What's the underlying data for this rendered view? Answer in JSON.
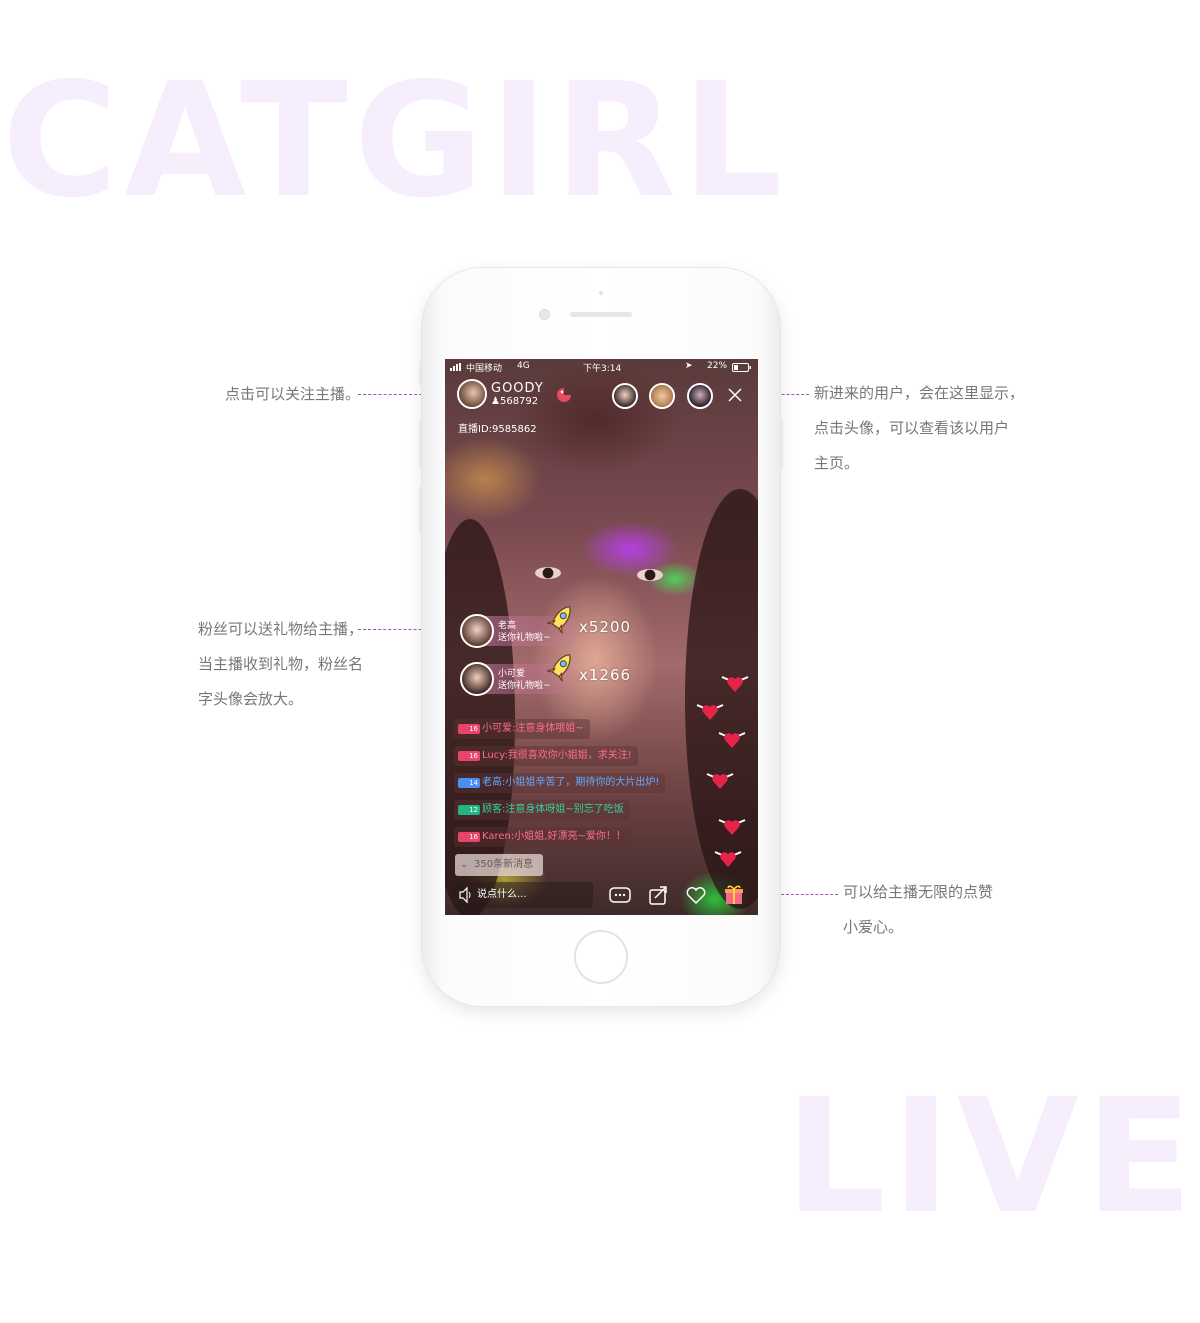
{
  "background_words": {
    "top": "CATGIRL",
    "bottom": "LIVE"
  },
  "annotations": {
    "follow": "点击可以关注主播。",
    "new_users": [
      "新进来的用户，会在这里显示，",
      "点击头像，可以查看该以用户",
      "主页。"
    ],
    "gifts": [
      "粉丝可以送礼物给主播，",
      "当主播收到礼物，粉丝名",
      "字头像会放大。"
    ],
    "likes": [
      "可以给主播无限的点赞",
      "小爱心。"
    ]
  },
  "status_bar": {
    "carrier": "中国移动",
    "network": "4G",
    "time": "下午3:14",
    "battery": "22%"
  },
  "host": {
    "name": "GOODY",
    "followers": "568792",
    "room_id": "直播ID:9585862"
  },
  "viewers_icons": [
    "viewer-avatar-icon",
    "viewer-avatar-icon",
    "viewer-avatar-icon"
  ],
  "gifts": [
    {
      "name": "老高",
      "text": "送你礼物啦~",
      "count": "x5200",
      "icon": "rocket-icon"
    },
    {
      "name": "小可爱",
      "text": "送你礼物啦~",
      "count": "x1266",
      "icon": "rocket-icon"
    }
  ],
  "messages": [
    {
      "level": "16",
      "text": "小可爱:注意身体哦姐~",
      "color": "#ff6b8a",
      "badge": "#e8456a"
    },
    {
      "level": "16",
      "text": "Lucy:我很喜欢你小姐姐，求关注!",
      "color": "#ff6b8a",
      "badge": "#e8456a"
    },
    {
      "level": "14",
      "text": "老高:小姐姐辛苦了，期待你的大片出炉!",
      "color": "#63a8ff",
      "badge": "#4a8ef0"
    },
    {
      "level": "12",
      "text": "顾客:注意身体呀姐~别忘了吃饭",
      "color": "#35d2a0",
      "badge": "#22b584"
    },
    {
      "level": "16",
      "text": "Karen:小姐姐,好漂亮~爱你！！",
      "color": "#ff6b8a",
      "badge": "#e8456a"
    }
  ],
  "new_messages": "350条新消息",
  "input_placeholder": "说点什么...",
  "accent_colors": {
    "annotation_line": "#a64fc4",
    "background_word": "#f6eefc"
  }
}
